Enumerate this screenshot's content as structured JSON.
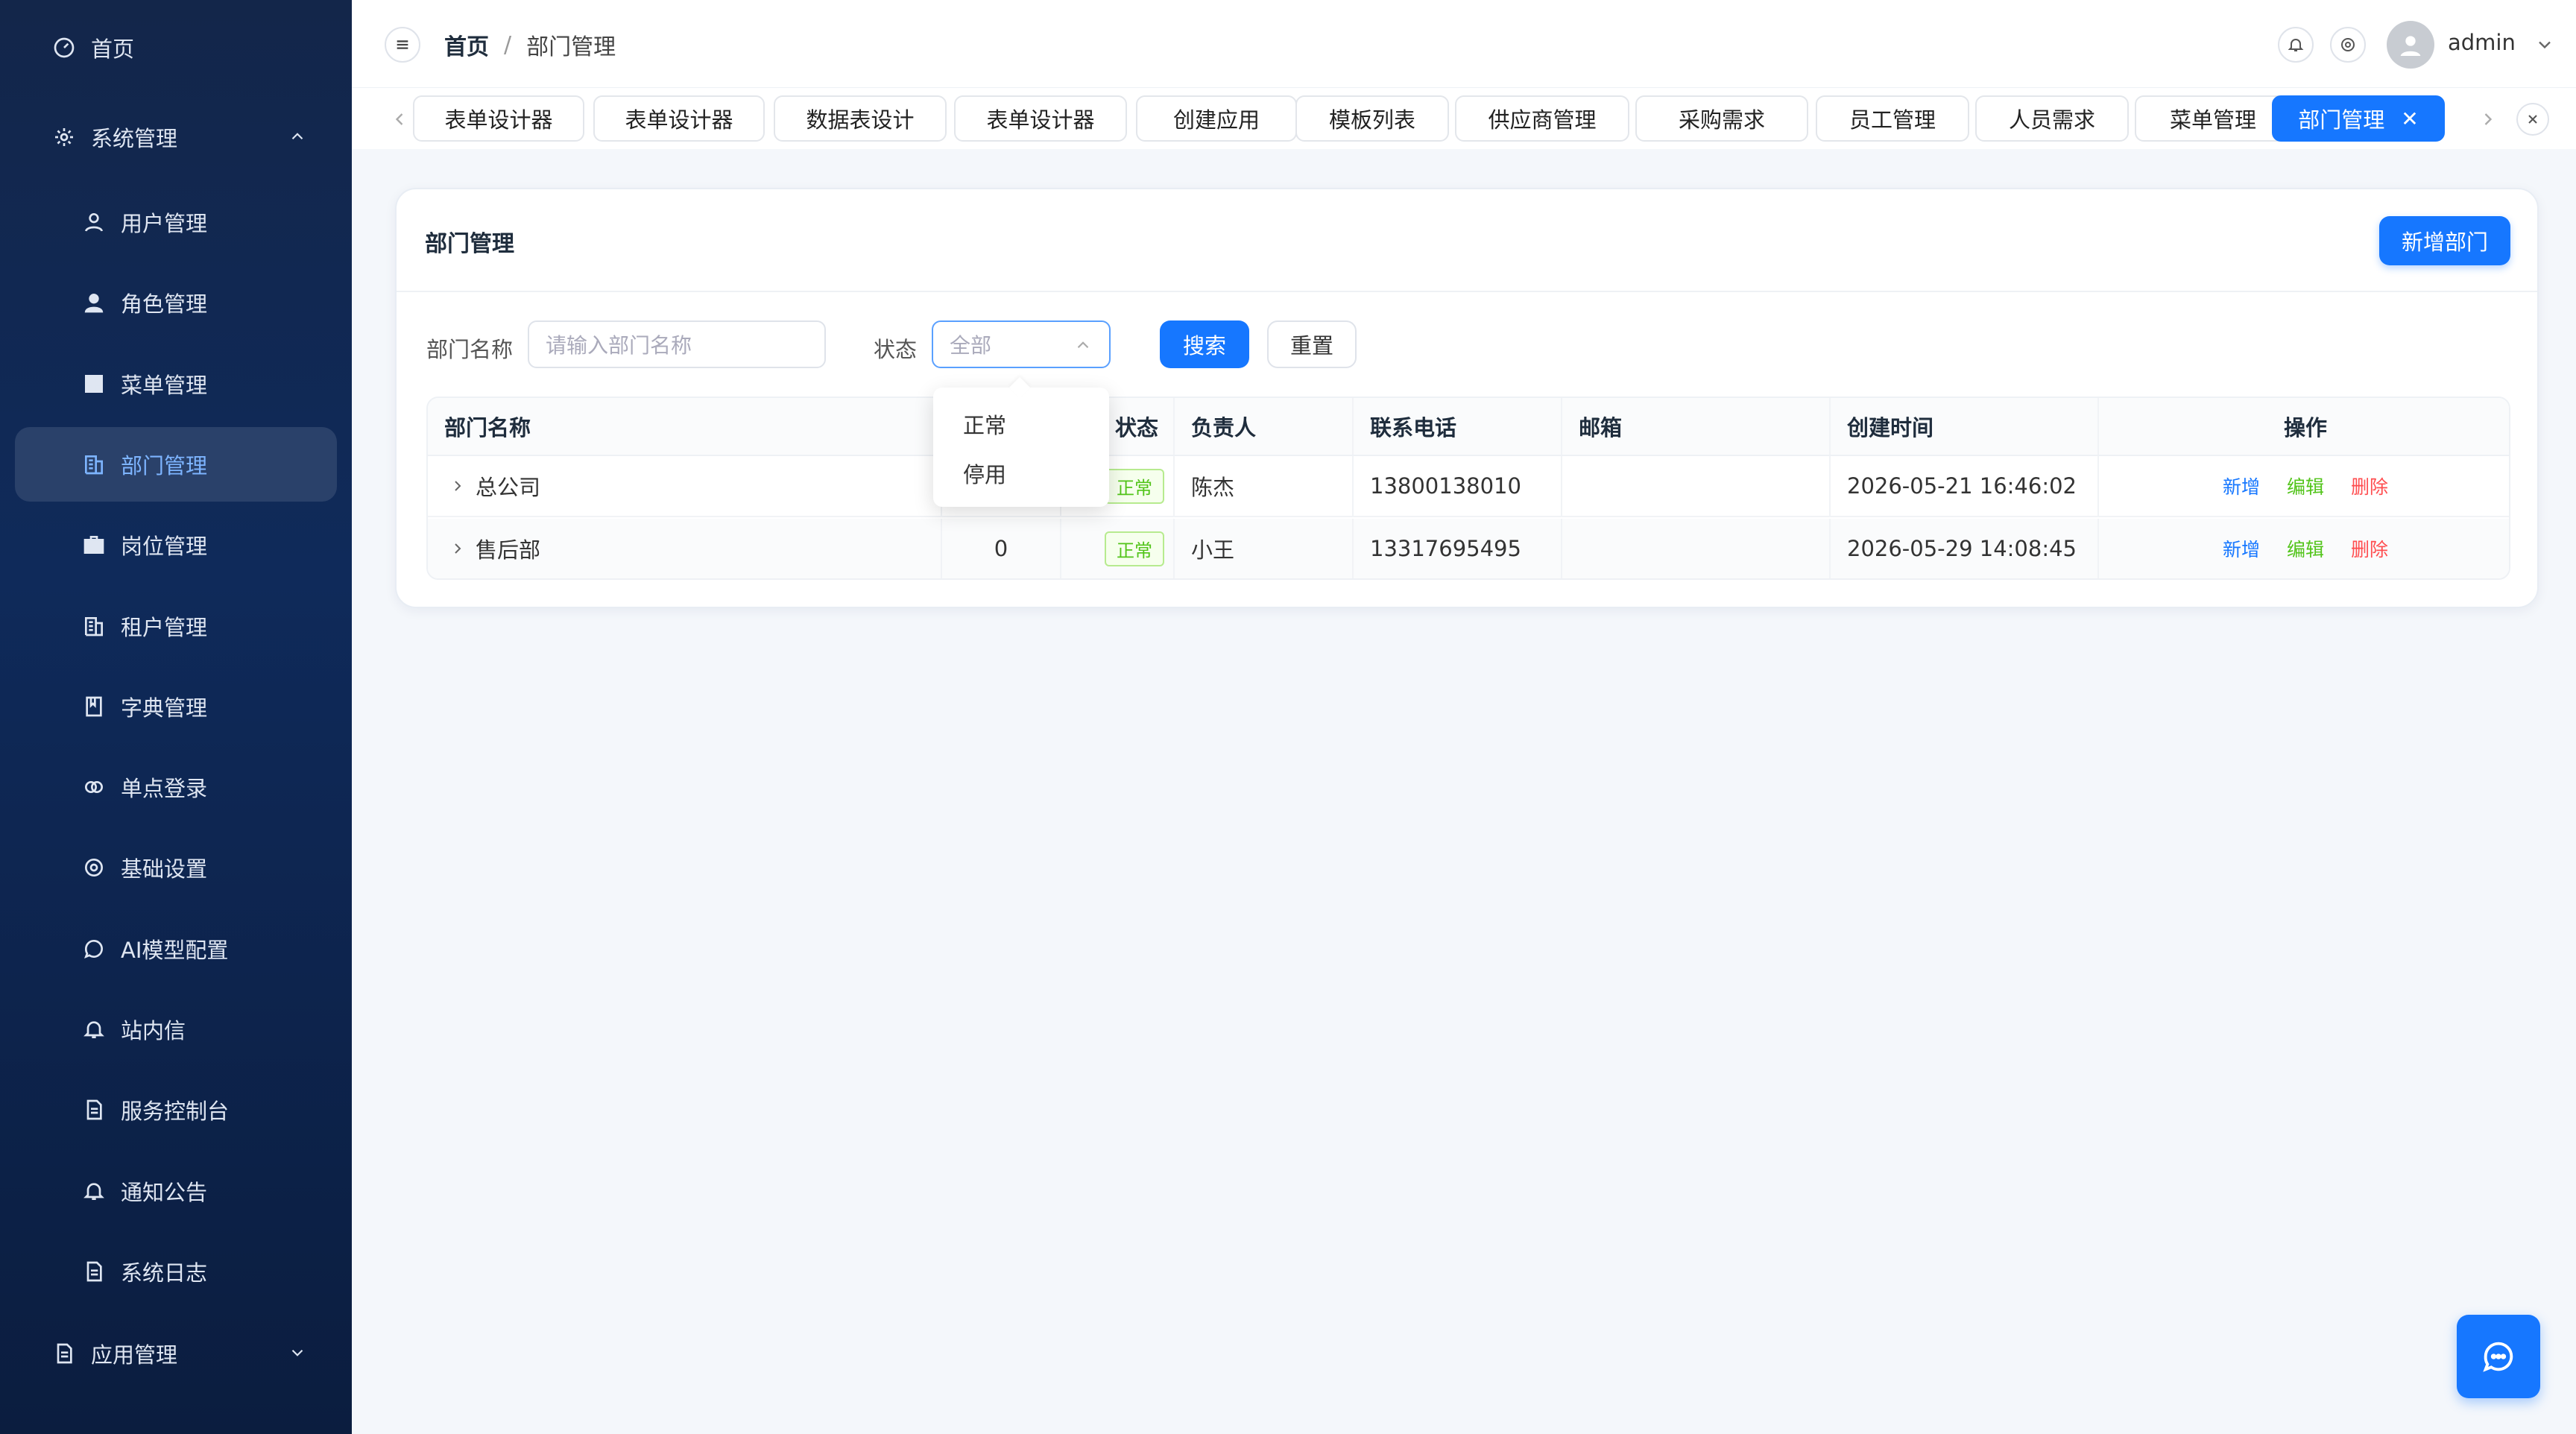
{
  "sidebar": {
    "home": "首页",
    "system": "系统管理",
    "items": [
      {
        "label": "用户管理",
        "icon": "user-icon"
      },
      {
        "label": "角色管理",
        "icon": "role-icon"
      },
      {
        "label": "菜单管理",
        "icon": "grid-icon"
      },
      {
        "label": "部门管理",
        "icon": "building-icon"
      },
      {
        "label": "岗位管理",
        "icon": "briefcase-icon"
      },
      {
        "label": "租户管理",
        "icon": "building-icon"
      },
      {
        "label": "字典管理",
        "icon": "book-icon"
      },
      {
        "label": "单点登录",
        "icon": "link-icon"
      },
      {
        "label": "基础设置",
        "icon": "gear-icon"
      },
      {
        "label": "AI模型配置",
        "icon": "chat-icon"
      },
      {
        "label": "站内信",
        "icon": "bell-icon"
      },
      {
        "label": "服务控制台",
        "icon": "document-icon"
      },
      {
        "label": "通知公告",
        "icon": "bell-icon"
      },
      {
        "label": "系统日志",
        "icon": "document-icon"
      }
    ],
    "app": "应用管理"
  },
  "header": {
    "breadcrumb_home": "首页",
    "breadcrumb_sep": "/",
    "breadcrumb_current": "部门管理",
    "username": "admin"
  },
  "tabs": [
    {
      "label": "表单设计器"
    },
    {
      "label": "表单设计器"
    },
    {
      "label": "数据表设计"
    },
    {
      "label": "表单设计器"
    },
    {
      "label": "创建应用"
    },
    {
      "label": "模板列表"
    },
    {
      "label": "供应商管理"
    },
    {
      "label": "采购需求"
    },
    {
      "label": "员工管理"
    },
    {
      "label": "人员需求"
    },
    {
      "label": "菜单管理"
    },
    {
      "label": "部门管理",
      "active": true
    }
  ],
  "card": {
    "title": "部门管理",
    "add_button": "新增部门"
  },
  "filters": {
    "name_label": "部门名称",
    "name_placeholder": "请输入部门名称",
    "status_label": "状态",
    "status_value": "全部",
    "search_button": "搜索",
    "reset_button": "重置"
  },
  "dropdown": {
    "options": [
      "正常",
      "停用"
    ]
  },
  "table": {
    "columns": [
      "部门名称",
      "",
      "状态",
      "负责人",
      "联系电话",
      "邮箱",
      "创建时间",
      "操作"
    ],
    "rows": [
      {
        "name": "总公司",
        "sort": "",
        "status": "正常",
        "leader": "陈杰",
        "phone": "13800138010",
        "email": "",
        "created": "2026-05-21 16:46:02"
      },
      {
        "name": "售后部",
        "sort": "0",
        "status": "正常",
        "leader": "小王",
        "phone": "13317695495",
        "email": "",
        "created": "2026-05-29 14:08:45"
      }
    ],
    "actions": {
      "add": "新增",
      "edit": "编辑",
      "delete": "删除"
    }
  },
  "colors": {
    "primary": "#1677ff",
    "sidebar_bg": "#13264a",
    "success": "#52c41a",
    "danger": "#ff4d4f"
  }
}
